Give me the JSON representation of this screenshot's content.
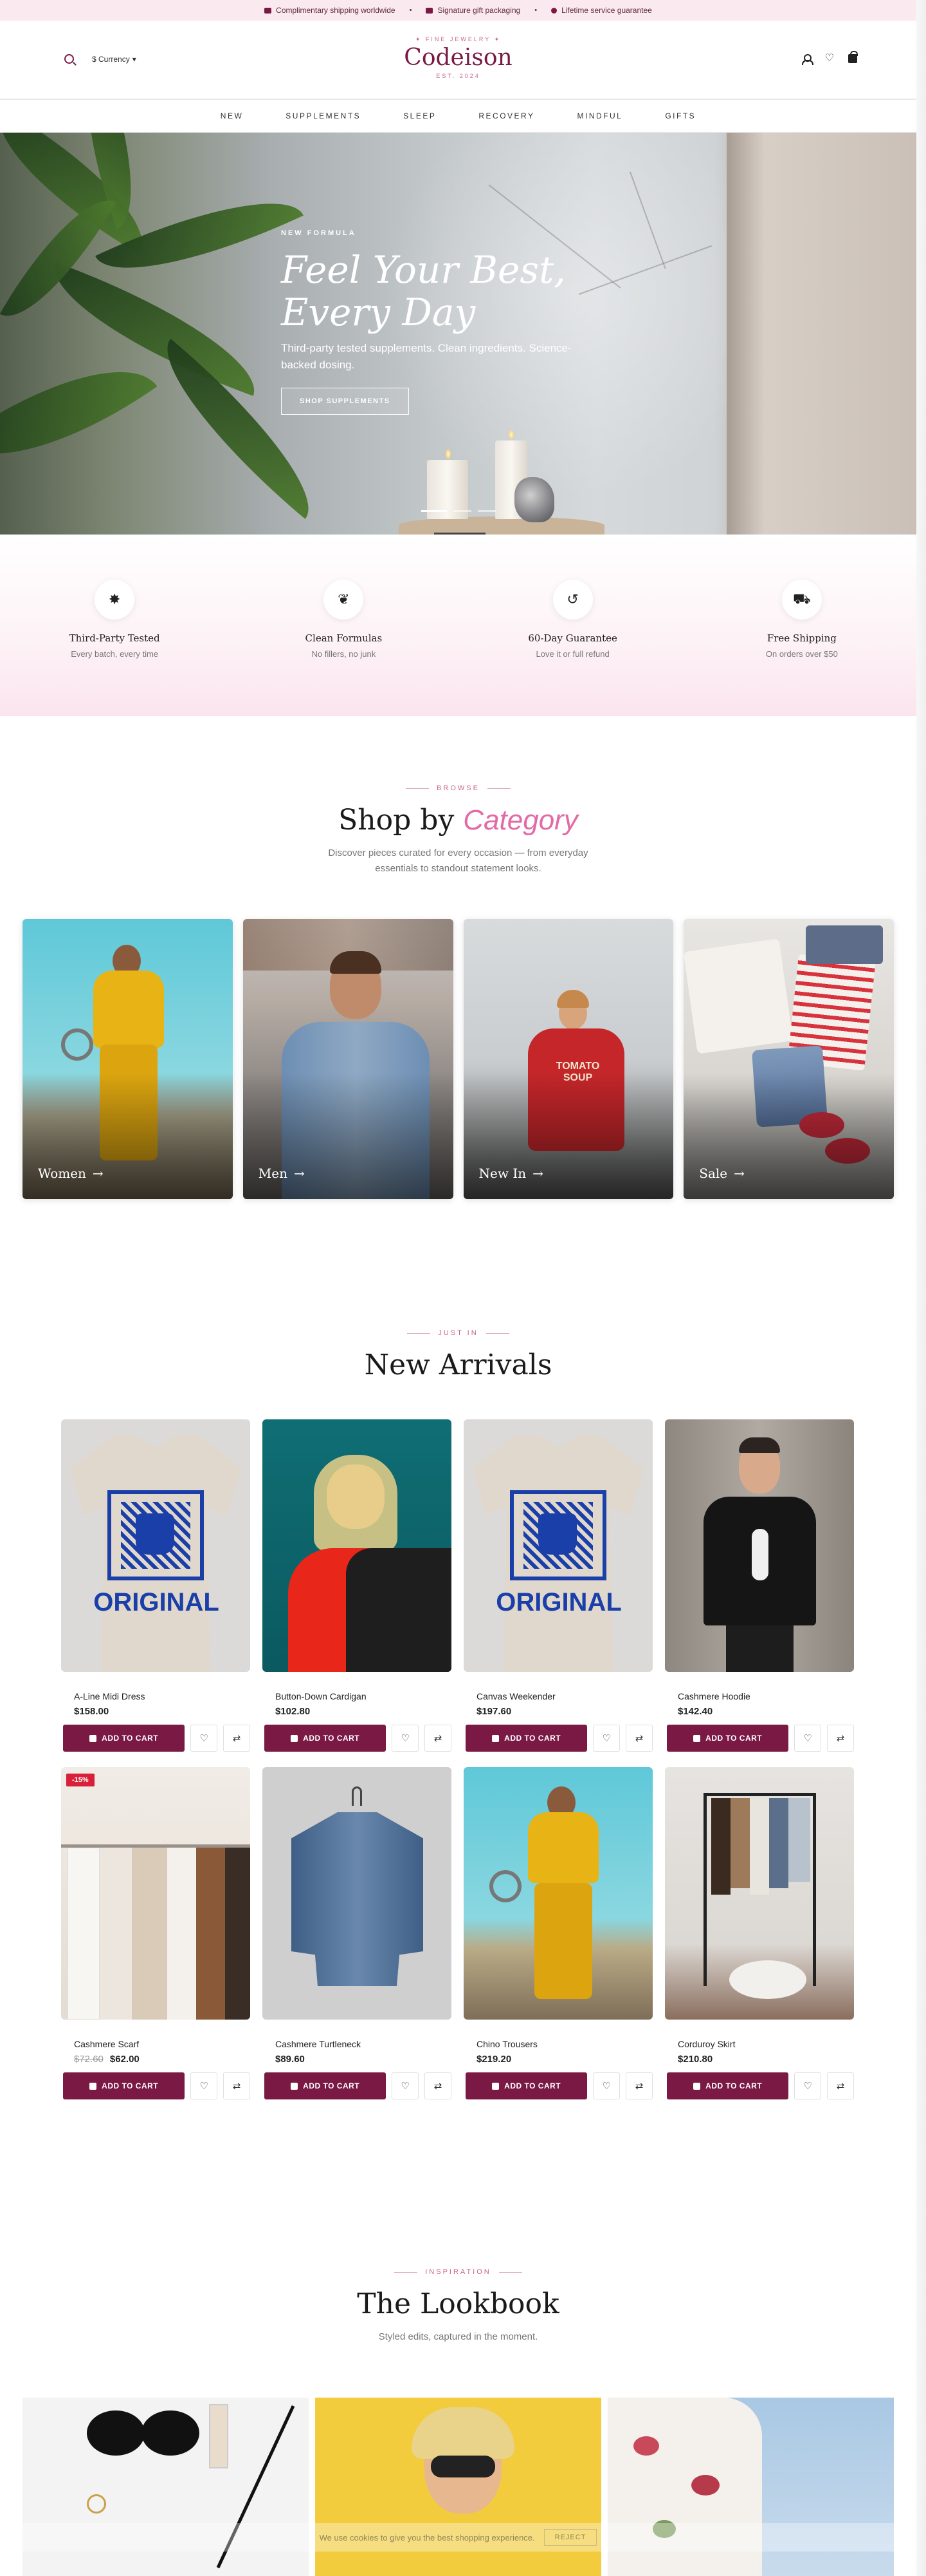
{
  "announcement": [
    {
      "icon": "truck-icon",
      "text": "Complimentary shipping worldwide"
    },
    {
      "icon": "gift-icon",
      "text": "Signature gift packaging"
    },
    {
      "icon": "star-icon",
      "text": "Lifetime service guarantee"
    }
  ],
  "header": {
    "currency_label": "$ Currency",
    "logo_tag": "✦ FINE JEWELRY ✦",
    "logo_name": "Codeison",
    "logo_est": "EST. 2024"
  },
  "nav": [
    "NEW",
    "SUPPLEMENTS",
    "SLEEP",
    "RECOVERY",
    "MINDFUL",
    "GIFTS"
  ],
  "hero": {
    "eyebrow": "NEW FORMULA",
    "title_line1": "Feel Your Best,",
    "title_line2": "Every Day",
    "subtitle": "Third-party tested supplements. Clean ingredients. Science-backed dosing.",
    "button": "SHOP SUPPLEMENTS"
  },
  "features": [
    {
      "icon": "badge-icon",
      "title": "Third-Party Tested",
      "sub": "Every batch, every time"
    },
    {
      "icon": "leaf-icon",
      "title": "Clean Formulas",
      "sub": "No fillers, no junk"
    },
    {
      "icon": "return-icon",
      "title": "60-Day Guarantee",
      "sub": "Love it or full refund"
    },
    {
      "icon": "truck-icon",
      "title": "Free Shipping",
      "sub": "On orders over $50"
    }
  ],
  "categories_section": {
    "eyebrow": "BROWSE",
    "title_plain": "Shop by ",
    "title_accent": "Category",
    "subtitle_line1": "Discover pieces curated for every occasion — from everyday",
    "subtitle_line2": "essentials to standout statement looks.",
    "items": [
      "Women",
      "Men",
      "New In",
      "Sale"
    ]
  },
  "arrivals_section": {
    "eyebrow": "JUST IN",
    "title": "New Arrivals",
    "cart_label": "ADD TO CART",
    "products": [
      {
        "name": "A-Line Midi Dress",
        "price": "$158.00",
        "old_price": "",
        "badge": ""
      },
      {
        "name": "Button-Down Cardigan",
        "price": "$102.80",
        "old_price": "",
        "badge": ""
      },
      {
        "name": "Canvas Weekender",
        "price": "$197.60",
        "old_price": "",
        "badge": ""
      },
      {
        "name": "Cashmere Hoodie",
        "price": "$142.40",
        "old_price": "",
        "badge": ""
      },
      {
        "name": "Cashmere Scarf",
        "price": "$62.00",
        "old_price": "$72.60",
        "badge": "-15%"
      },
      {
        "name": "Cashmere Turtleneck",
        "price": "$89.60",
        "old_price": "",
        "badge": ""
      },
      {
        "name": "Chino Trousers",
        "price": "$219.20",
        "old_price": "",
        "badge": ""
      },
      {
        "name": "Corduroy Skirt",
        "price": "$210.80",
        "old_price": "",
        "badge": ""
      }
    ],
    "tee_word": "ORIGINAL"
  },
  "lookbook_section": {
    "eyebrow": "INSPIRATION",
    "title": "The Lookbook",
    "subtitle": "Styled edits, captured in the moment."
  },
  "cookie": {
    "text": "We use cookies to give you the best shopping experience.",
    "reject": "REJECT"
  },
  "colors": {
    "brand": "#7a1a44",
    "accent_pink": "#e26aa7",
    "badge_red": "#d8203a",
    "announcement_bg": "#fbe9f0"
  }
}
